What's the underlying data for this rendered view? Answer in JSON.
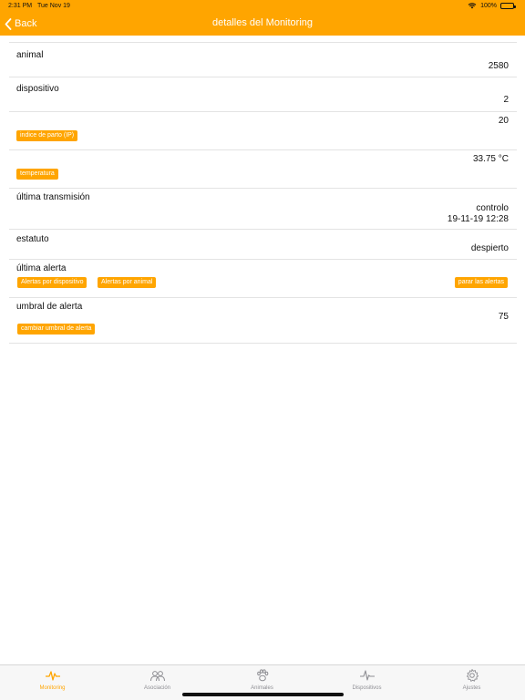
{
  "status_bar": {
    "time": "2:31 PM",
    "date": "Tue Nov 19",
    "battery": "100%"
  },
  "nav": {
    "back_label": "Back",
    "title": "detalles del Monitoring"
  },
  "rows": {
    "animal": {
      "label": "animal",
      "value": "2580"
    },
    "dispositivo": {
      "label": "dispositivo",
      "value": "2"
    },
    "ip": {
      "value": "20",
      "tag": "indice de parto (IP)"
    },
    "temperatura": {
      "value": "33.75 °C",
      "tag": "temperatura"
    },
    "ultima_transmision": {
      "label": "última transmisión",
      "value_line1": "controlo",
      "value_line2": "19-11-19 12:28"
    },
    "estatuto": {
      "label": "estatuto",
      "value": "despierto"
    },
    "ultima_alerta": {
      "label": "última alerta",
      "btn_dispositivo": "Alertas por dispositivo",
      "btn_animal": "Alertas por animal",
      "btn_parar": "parar las alertas"
    },
    "umbral": {
      "label": "umbral de alerta",
      "value": "75",
      "btn_cambiar": "cambiar umbral de alerta"
    }
  },
  "tabs": [
    {
      "label": "Monitoring",
      "icon": "pulse-icon",
      "active": true
    },
    {
      "label": "Asociación",
      "icon": "group-icon",
      "active": false
    },
    {
      "label": "Animales",
      "icon": "paw-icon",
      "active": false
    },
    {
      "label": "Dispositivos",
      "icon": "device-pulse-icon",
      "active": false
    },
    {
      "label": "Ajustes",
      "icon": "gear-icon",
      "active": false
    }
  ],
  "colors": {
    "accent": "#ffa500",
    "inactive_tab": "#8e8e93"
  }
}
